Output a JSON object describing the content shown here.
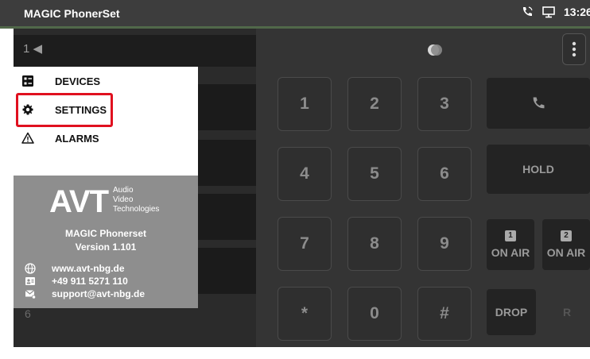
{
  "titlebar": {
    "title": "MAGIC PhonerSet",
    "time": "13:26"
  },
  "app": {
    "line_selector": "1 ◀",
    "left_row_hint": "6",
    "keypad": [
      "1",
      "2",
      "3",
      "4",
      "5",
      "6",
      "7",
      "8",
      "9",
      "*",
      "0",
      "#"
    ],
    "hold_label": "HOLD",
    "on_air_1": {
      "badge": "1",
      "label": "ON AIR"
    },
    "on_air_2": {
      "badge": "2",
      "label": "ON AIR"
    },
    "drop_label": "DROP",
    "r_label": "R"
  },
  "drawer": {
    "menu": [
      {
        "label": "DEVICES",
        "icon": "devices-icon"
      },
      {
        "label": "SETTINGS",
        "icon": "gear-icon"
      },
      {
        "label": "ALARMS",
        "icon": "warning-icon"
      }
    ],
    "logo_letters": "AVT",
    "logo_sub": [
      "Audio",
      "Video",
      "Technologies"
    ],
    "product_name": "MAGIC Phonerset",
    "product_version": "Version  1.101",
    "contacts": [
      {
        "icon": "globe-icon",
        "text": "www.avt-nbg.de"
      },
      {
        "icon": "contact-card-icon",
        "text": "+49 911 5271 110"
      },
      {
        "icon": "mail-icon",
        "text": "support@avt-nbg.de"
      }
    ],
    "highlight_color": "#e0101f"
  },
  "colors": {
    "titlebar": "#3d3d3d",
    "accent_line": "#51684a",
    "panel": "#343434"
  }
}
